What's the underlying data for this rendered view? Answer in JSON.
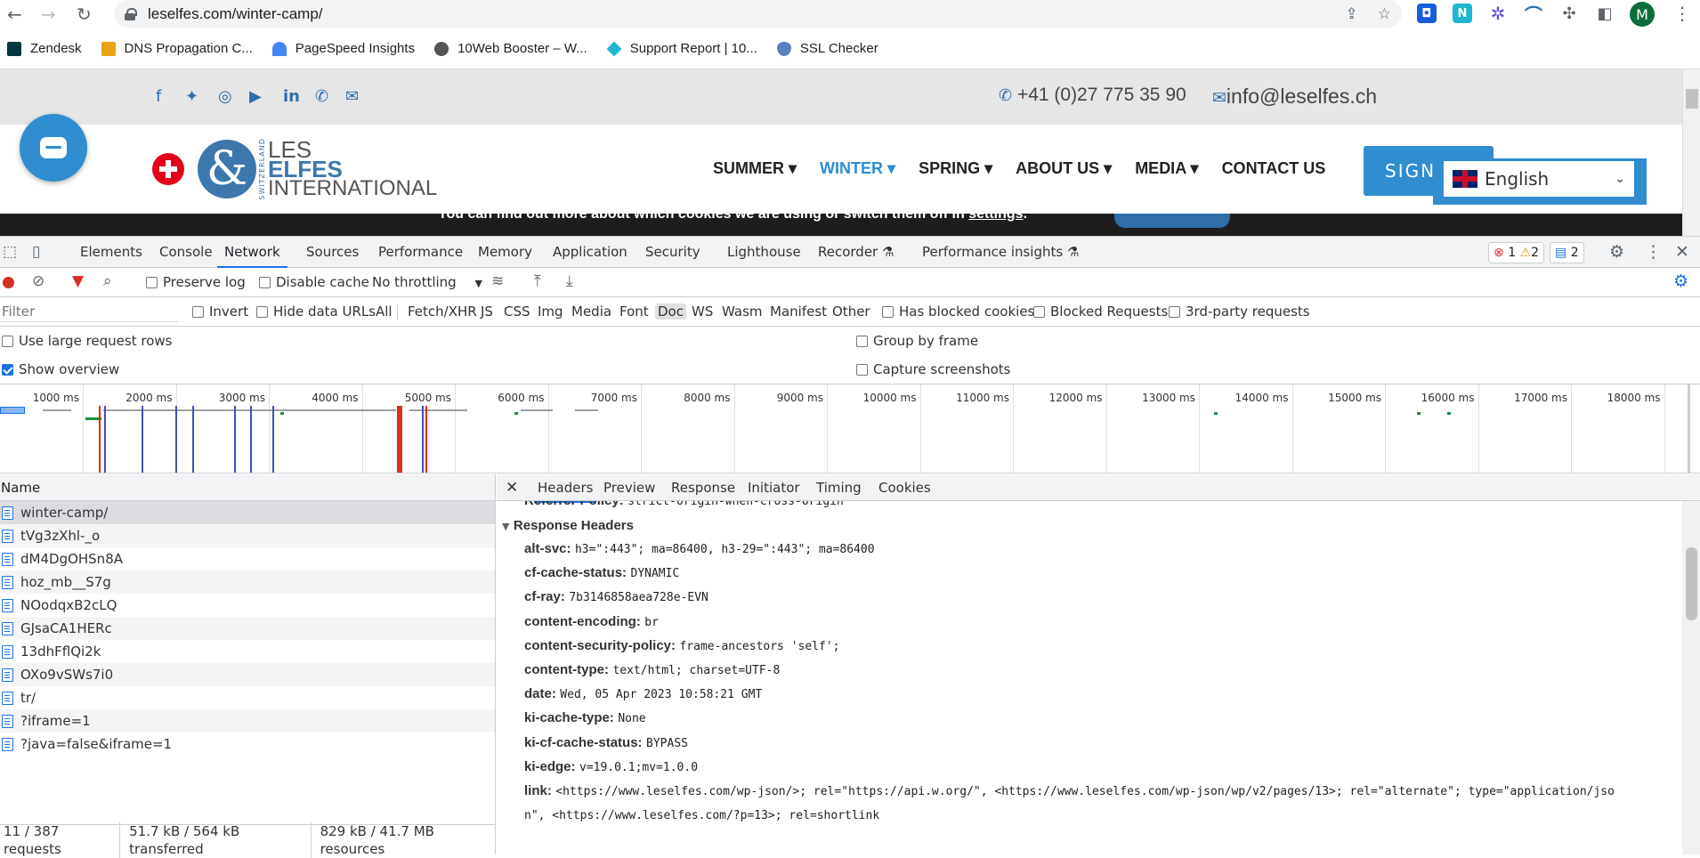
{
  "browser": {
    "url": "leselfes.com/winter-camp/",
    "avatar_letter": "M",
    "bookmarks": [
      {
        "label": "Zendesk",
        "color": "#03363d"
      },
      {
        "label": "DNS Propagation C...",
        "color": "#e8a317"
      },
      {
        "label": "PageSpeed Insights",
        "color": "#4285f4"
      },
      {
        "label": "10Web Booster – W...",
        "color": "#555555"
      },
      {
        "label": "Support Report | 10...",
        "color": "#1fb6d3"
      },
      {
        "label": "SSL Checker",
        "color": "#5b7fbf"
      }
    ]
  },
  "site": {
    "phone": "+41 (0)27 775 35 90",
    "email": "info@leselfes.ch",
    "logo": {
      "vertical": "SWITZERLAND",
      "line1": "LES",
      "line2": "ELFES",
      "line3": "INTERNATIONAL"
    },
    "nav": [
      {
        "label": "SUMMER ▾",
        "active": false
      },
      {
        "label": "WINTER ▾",
        "active": true
      },
      {
        "label": "SPRING ▾",
        "active": false
      },
      {
        "label": "ABOUT US ▾",
        "active": false
      },
      {
        "label": "MEDIA ▾",
        "active": false
      },
      {
        "label": "CONTACT US",
        "active": false
      }
    ],
    "sign_label": "SIGN",
    "language": "English",
    "cookie_text": "You can find out more about which cookies we are using or switch them off in ",
    "cookie_link": "settings",
    "cookie_end": "."
  },
  "devtools": {
    "tabs": [
      "Elements",
      "Console",
      "Network",
      "Sources",
      "Performance",
      "Memory",
      "Application",
      "Security",
      "Lighthouse",
      "Recorder ⚗",
      "Performance insights ⚗"
    ],
    "active_tab": "Network",
    "badges": {
      "errors": "1",
      "warnings": "2",
      "messages": "2"
    },
    "toolbar": {
      "preserve_log": "Preserve log",
      "disable_cache": "Disable cache",
      "throttling": "No throttling"
    },
    "filter": {
      "placeholder": "Filter",
      "invert": "Invert",
      "hide_data_urls": "Hide data URLs",
      "types": [
        "All",
        "Fetch/XHR",
        "JS",
        "CSS",
        "Img",
        "Media",
        "Font",
        "Doc",
        "WS",
        "Wasm",
        "Manifest",
        "Other"
      ],
      "selected_type": "Doc",
      "has_blocked_cookies": "Has blocked cookies",
      "blocked_requests": "Blocked Requests",
      "third_party": "3rd-party requests"
    },
    "options": {
      "large_rows": "Use large request rows",
      "show_overview": "Show overview",
      "group_by_frame": "Group by frame",
      "capture_screenshots": "Capture screenshots"
    },
    "overview_ticks": [
      "1000 ms",
      "2000 ms",
      "3000 ms",
      "4000 ms",
      "5000 ms",
      "6000 ms",
      "7000 ms",
      "8000 ms",
      "9000 ms",
      "10000 ms",
      "11000 ms",
      "12000 ms",
      "13000 ms",
      "14000 ms",
      "15000 ms",
      "16000 ms",
      "17000 ms",
      "18000 ms"
    ],
    "name_header": "Name",
    "requests": [
      "winter-camp/",
      "tVg3zXhl-_o",
      "dM4DgOHSn8A",
      "hoz_mb__S7g",
      "NOodqxB2cLQ",
      "GJsaCA1HERc",
      "13dhFflQi2k",
      "OXo9vSWs7i0",
      "tr/",
      "?iframe=1",
      "?java=false&iframe=1"
    ],
    "status": {
      "requests": "11 / 387 requests",
      "transferred": "51.7 kB / 564 kB transferred",
      "resources": "829 kB / 41.7 MB resources"
    },
    "detail_tabs": [
      "Headers",
      "Preview",
      "Response",
      "Initiator",
      "Timing",
      "Cookies"
    ],
    "partial_row": {
      "key": "Referrer Policy:",
      "value": "strict-origin-when-cross-origin"
    },
    "section_title": "Response Headers",
    "headers": [
      {
        "key": "alt-svc:",
        "value": "h3=\":443\"; ma=86400, h3-29=\":443\"; ma=86400"
      },
      {
        "key": "cf-cache-status:",
        "value": "DYNAMIC"
      },
      {
        "key": "cf-ray:",
        "value": "7b3146858aea728e-EVN"
      },
      {
        "key": "content-encoding:",
        "value": "br"
      },
      {
        "key": "content-security-policy:",
        "value": "frame-ancestors 'self';"
      },
      {
        "key": "content-type:",
        "value": "text/html; charset=UTF-8"
      },
      {
        "key": "date:",
        "value": "Wed, 05 Apr 2023 10:58:21 GMT"
      },
      {
        "key": "ki-cache-type:",
        "value": "None"
      },
      {
        "key": "ki-cf-cache-status:",
        "value": "BYPASS"
      },
      {
        "key": "ki-edge:",
        "value": "v=19.0.1;mv=1.0.0"
      },
      {
        "key": "link:",
        "value": "<https://www.leselfes.com/wp-json/>; rel=\"https://api.w.org/\", <https://www.leselfes.com/wp-json/wp/v2/pages/13>; rel=\"alternate\"; type=\"application/jso"
      },
      {
        "key": "",
        "value": "n\", <https://www.leselfes.com/?p=13>; rel=shortlink"
      }
    ]
  }
}
